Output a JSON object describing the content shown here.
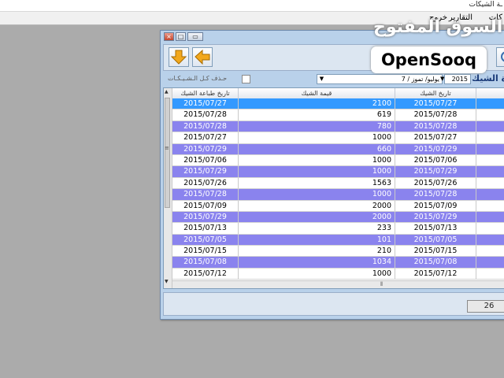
{
  "app": {
    "title": "ـة الشيكات",
    "menu": [
      "كات",
      "التقارير",
      "خروج"
    ]
  },
  "window": {
    "buttons": {
      "close": "×",
      "maximize": "□",
      "minimize": "▭"
    }
  },
  "toolbar": {
    "icons": [
      "arrow-down-icon",
      "arrow-left-icon",
      "refresh-icon"
    ],
    "accent": "#f2a81d"
  },
  "filter": {
    "delete_all_label": "حـذف كـل الـشـيـكـات",
    "month_value": "يوليو/ تموز / 7",
    "year_value": "2015",
    "check_label": "ة الشيك"
  },
  "grid": {
    "columns": [
      "تاريخ طباعة الشيك",
      "قيمة الشيك",
      "تاريخ الشيك",
      ""
    ],
    "rows": [
      {
        "print_date": "2015/07/27",
        "amount": "2100",
        "check_date": "2015/07/27",
        "style": "sel"
      },
      {
        "print_date": "2015/07/28",
        "amount": "619",
        "check_date": "2015/07/28",
        "style": "even"
      },
      {
        "print_date": "2015/07/28",
        "amount": "780",
        "check_date": "2015/07/28",
        "style": "odd"
      },
      {
        "print_date": "2015/07/27",
        "amount": "1000",
        "check_date": "2015/07/27",
        "style": "even"
      },
      {
        "print_date": "2015/07/29",
        "amount": "660",
        "check_date": "2015/07/29",
        "style": "odd"
      },
      {
        "print_date": "2015/07/06",
        "amount": "1000",
        "check_date": "2015/07/06",
        "style": "even"
      },
      {
        "print_date": "2015/07/29",
        "amount": "1000",
        "check_date": "2015/07/29",
        "style": "odd"
      },
      {
        "print_date": "2015/07/26",
        "amount": "1563",
        "check_date": "2015/07/26",
        "style": "even"
      },
      {
        "print_date": "2015/07/28",
        "amount": "1000",
        "check_date": "2015/07/28",
        "style": "odd"
      },
      {
        "print_date": "2015/07/09",
        "amount": "2000",
        "check_date": "2015/07/09",
        "style": "even"
      },
      {
        "print_date": "2015/07/29",
        "amount": "2000",
        "check_date": "2015/07/29",
        "style": "odd"
      },
      {
        "print_date": "2015/07/13",
        "amount": "233",
        "check_date": "2015/07/13",
        "style": "even"
      },
      {
        "print_date": "2015/07/05",
        "amount": "101",
        "check_date": "2015/07/05",
        "style": "odd"
      },
      {
        "print_date": "2015/07/15",
        "amount": "210",
        "check_date": "2015/07/15",
        "style": "even"
      },
      {
        "print_date": "2015/07/08",
        "amount": "1034",
        "check_date": "2015/07/08",
        "style": "odd"
      },
      {
        "print_date": "2015/07/12",
        "amount": "1000",
        "check_date": "2015/07/12",
        "style": "even"
      }
    ],
    "row_colors": {
      "odd": "#8a83ee",
      "selected": "#3399ff"
    }
  },
  "status": {
    "count": "26"
  },
  "watermark": {
    "arabic": "السوق المفتوح",
    "english": "OpenSooq"
  }
}
